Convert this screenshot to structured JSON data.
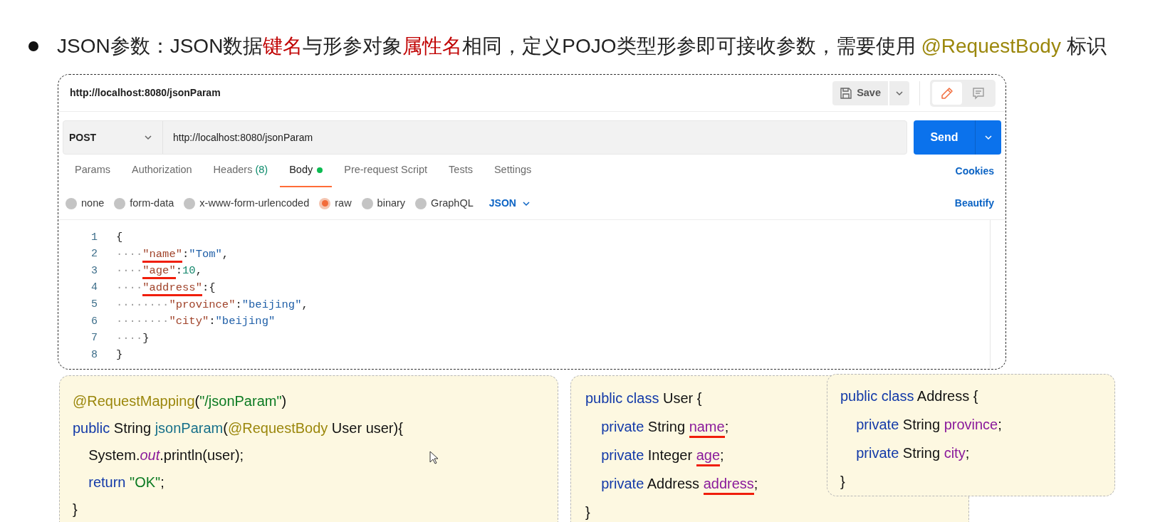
{
  "heading": {
    "segments": [
      {
        "text": "JSON参数：JSON数据",
        "kind": "plain"
      },
      {
        "text": "键名",
        "kind": "highlight"
      },
      {
        "text": "与形参对象",
        "kind": "plain"
      },
      {
        "text": "属性名",
        "kind": "highlight"
      },
      {
        "text": "相同，定义POJO类型形参即可接收参数，需要使用 ",
        "kind": "plain"
      },
      {
        "text": "@RequestBody",
        "kind": "annotation"
      },
      {
        "text": " 标识",
        "kind": "plain"
      }
    ]
  },
  "postman": {
    "title": "http://localhost:8080/jsonParam",
    "save_button": "Save",
    "view_modes": [
      {
        "kind": "edit",
        "selected": true
      },
      {
        "kind": "comments",
        "selected": false
      }
    ],
    "method": "POST",
    "url": "http://localhost:8080/jsonParam",
    "send_button": "Send",
    "tabs": [
      {
        "label": "Params",
        "selected": false,
        "has_content": false
      },
      {
        "label": "Authorization",
        "selected": false,
        "has_content": false
      },
      {
        "label": "Headers",
        "count": "(8)",
        "selected": false,
        "has_content": false
      },
      {
        "label": "Body",
        "selected": true,
        "has_content": true
      },
      {
        "label": "Pre-request Script",
        "selected": false,
        "has_content": false
      },
      {
        "label": "Tests",
        "selected": false,
        "has_content": false
      },
      {
        "label": "Settings",
        "selected": false,
        "has_content": false
      }
    ],
    "cookies_link": "Cookies",
    "body_types": [
      {
        "label": "none",
        "selected": false
      },
      {
        "label": "form-data",
        "selected": false
      },
      {
        "label": "x-www-form-urlencoded",
        "selected": false
      },
      {
        "label": "raw",
        "selected": true
      },
      {
        "label": "binary",
        "selected": false
      },
      {
        "label": "GraphQL",
        "selected": false
      }
    ],
    "format": "JSON",
    "beautify_link": "Beautify",
    "editor_lines": [
      {
        "number": "1",
        "segments": [
          {
            "text": "{",
            "kind": "punct",
            "underlined": false
          }
        ]
      },
      {
        "number": "2",
        "segments": [
          {
            "text": "····",
            "kind": "whitespace",
            "underlined": false
          },
          {
            "text": "\"name\"",
            "kind": "key",
            "underlined": true
          },
          {
            "text": ":",
            "kind": "punct",
            "underlined": false
          },
          {
            "text": "\"Tom\"",
            "kind": "string",
            "underlined": false
          },
          {
            "text": ",",
            "kind": "punct",
            "underlined": false
          }
        ]
      },
      {
        "number": "3",
        "segments": [
          {
            "text": "····",
            "kind": "whitespace",
            "underlined": false
          },
          {
            "text": "\"age\"",
            "kind": "key",
            "underlined": true
          },
          {
            "text": ":",
            "kind": "punct",
            "underlined": false
          },
          {
            "text": "10",
            "kind": "number",
            "underlined": false
          },
          {
            "text": ",",
            "kind": "punct",
            "underlined": false
          }
        ]
      },
      {
        "number": "4",
        "segments": [
          {
            "text": "····",
            "kind": "whitespace",
            "underlined": false
          },
          {
            "text": "\"address\"",
            "kind": "key",
            "underlined": true
          },
          {
            "text": ":{",
            "kind": "punct",
            "underlined": false
          }
        ]
      },
      {
        "number": "5",
        "segments": [
          {
            "text": "········",
            "kind": "whitespace",
            "underlined": false
          },
          {
            "text": "\"province\"",
            "kind": "key",
            "underlined": false
          },
          {
            "text": ":",
            "kind": "punct",
            "underlined": false
          },
          {
            "text": "\"beijing\"",
            "kind": "string",
            "underlined": false
          },
          {
            "text": ",",
            "kind": "punct",
            "underlined": false
          }
        ]
      },
      {
        "number": "6",
        "segments": [
          {
            "text": "········",
            "kind": "whitespace",
            "underlined": false
          },
          {
            "text": "\"city\"",
            "kind": "key",
            "underlined": false
          },
          {
            "text": ":",
            "kind": "punct",
            "underlined": false
          },
          {
            "text": "\"beijing\"",
            "kind": "string",
            "underlined": false
          }
        ]
      },
      {
        "number": "7",
        "segments": [
          {
            "text": "····",
            "kind": "whitespace",
            "underlined": false
          },
          {
            "text": "}",
            "kind": "punct",
            "underlined": false
          }
        ]
      },
      {
        "number": "8",
        "segments": [
          {
            "text": "}",
            "kind": "punct",
            "underlined": false
          }
        ]
      }
    ]
  },
  "code_cards": [
    {
      "lines": [
        {
          "segments": [
            {
              "text": "@RequestMapping",
              "kind": "annotation",
              "underlined": false
            },
            {
              "text": "(",
              "kind": "plain",
              "underlined": false
            },
            {
              "text": "\"/jsonParam\"",
              "kind": "string",
              "underlined": false
            },
            {
              "text": ")",
              "kind": "plain",
              "underlined": false
            }
          ]
        },
        {
          "segments": [
            {
              "text": "public ",
              "kind": "keyword",
              "underlined": false
            },
            {
              "text": "String ",
              "kind": "plain",
              "underlined": false
            },
            {
              "text": "jsonParam",
              "kind": "method",
              "underlined": false
            },
            {
              "text": "(",
              "kind": "plain",
              "underlined": false
            },
            {
              "text": "@RequestBody ",
              "kind": "annotation",
              "underlined": false
            },
            {
              "text": "User user){",
              "kind": "plain",
              "underlined": false
            }
          ]
        },
        {
          "segments": [
            {
              "text": "    System.",
              "kind": "plain",
              "underlined": false
            },
            {
              "text": "out",
              "kind": "static",
              "underlined": false
            },
            {
              "text": ".println(user);",
              "kind": "plain",
              "underlined": false
            }
          ]
        },
        {
          "segments": [
            {
              "text": "    return ",
              "kind": "keyword",
              "underlined": false
            },
            {
              "text": "\"OK\"",
              "kind": "string",
              "underlined": false
            },
            {
              "text": ";",
              "kind": "plain",
              "underlined": false
            }
          ]
        },
        {
          "segments": [
            {
              "text": "}",
              "kind": "plain",
              "underlined": false
            }
          ]
        }
      ]
    },
    {
      "lines": [
        {
          "segments": [
            {
              "text": "public class ",
              "kind": "keyword",
              "underlined": false
            },
            {
              "text": "User {",
              "kind": "plain",
              "underlined": false
            }
          ]
        },
        {
          "segments": [
            {
              "text": "    private ",
              "kind": "keyword",
              "underlined": false
            },
            {
              "text": "String ",
              "kind": "plain",
              "underlined": false
            },
            {
              "text": "name",
              "kind": "field",
              "underlined": true
            },
            {
              "text": ";",
              "kind": "plain",
              "underlined": false
            }
          ]
        },
        {
          "segments": [
            {
              "text": "    private ",
              "kind": "keyword",
              "underlined": false
            },
            {
              "text": "Integer ",
              "kind": "plain",
              "underlined": false
            },
            {
              "text": "age",
              "kind": "field",
              "underlined": true
            },
            {
              "text": ";",
              "kind": "plain",
              "underlined": false
            }
          ]
        },
        {
          "segments": [
            {
              "text": "    private ",
              "kind": "keyword",
              "underlined": false
            },
            {
              "text": "Address ",
              "kind": "plain",
              "underlined": false
            },
            {
              "text": "address",
              "kind": "field",
              "underlined": true
            },
            {
              "text": ";",
              "kind": "plain",
              "underlined": false
            }
          ]
        },
        {
          "segments": [
            {
              "text": "}",
              "kind": "plain",
              "underlined": false
            }
          ]
        }
      ]
    },
    {
      "lines": [
        {
          "segments": [
            {
              "text": "public class ",
              "kind": "keyword",
              "underlined": false
            },
            {
              "text": "Address {",
              "kind": "plain",
              "underlined": false
            }
          ]
        },
        {
          "segments": [
            {
              "text": "    private ",
              "kind": "keyword",
              "underlined": false
            },
            {
              "text": "String ",
              "kind": "plain",
              "underlined": false
            },
            {
              "text": "province",
              "kind": "field",
              "underlined": false
            },
            {
              "text": ";",
              "kind": "plain",
              "underlined": false
            }
          ]
        },
        {
          "segments": [
            {
              "text": "    private ",
              "kind": "keyword",
              "underlined": false
            },
            {
              "text": "String ",
              "kind": "plain",
              "underlined": false
            },
            {
              "text": "city",
              "kind": "field",
              "underlined": false
            },
            {
              "text": ";",
              "kind": "plain",
              "underlined": false
            }
          ]
        },
        {
          "segments": [
            {
              "text": "}",
              "kind": "plain",
              "underlined": false
            }
          ]
        }
      ]
    }
  ]
}
